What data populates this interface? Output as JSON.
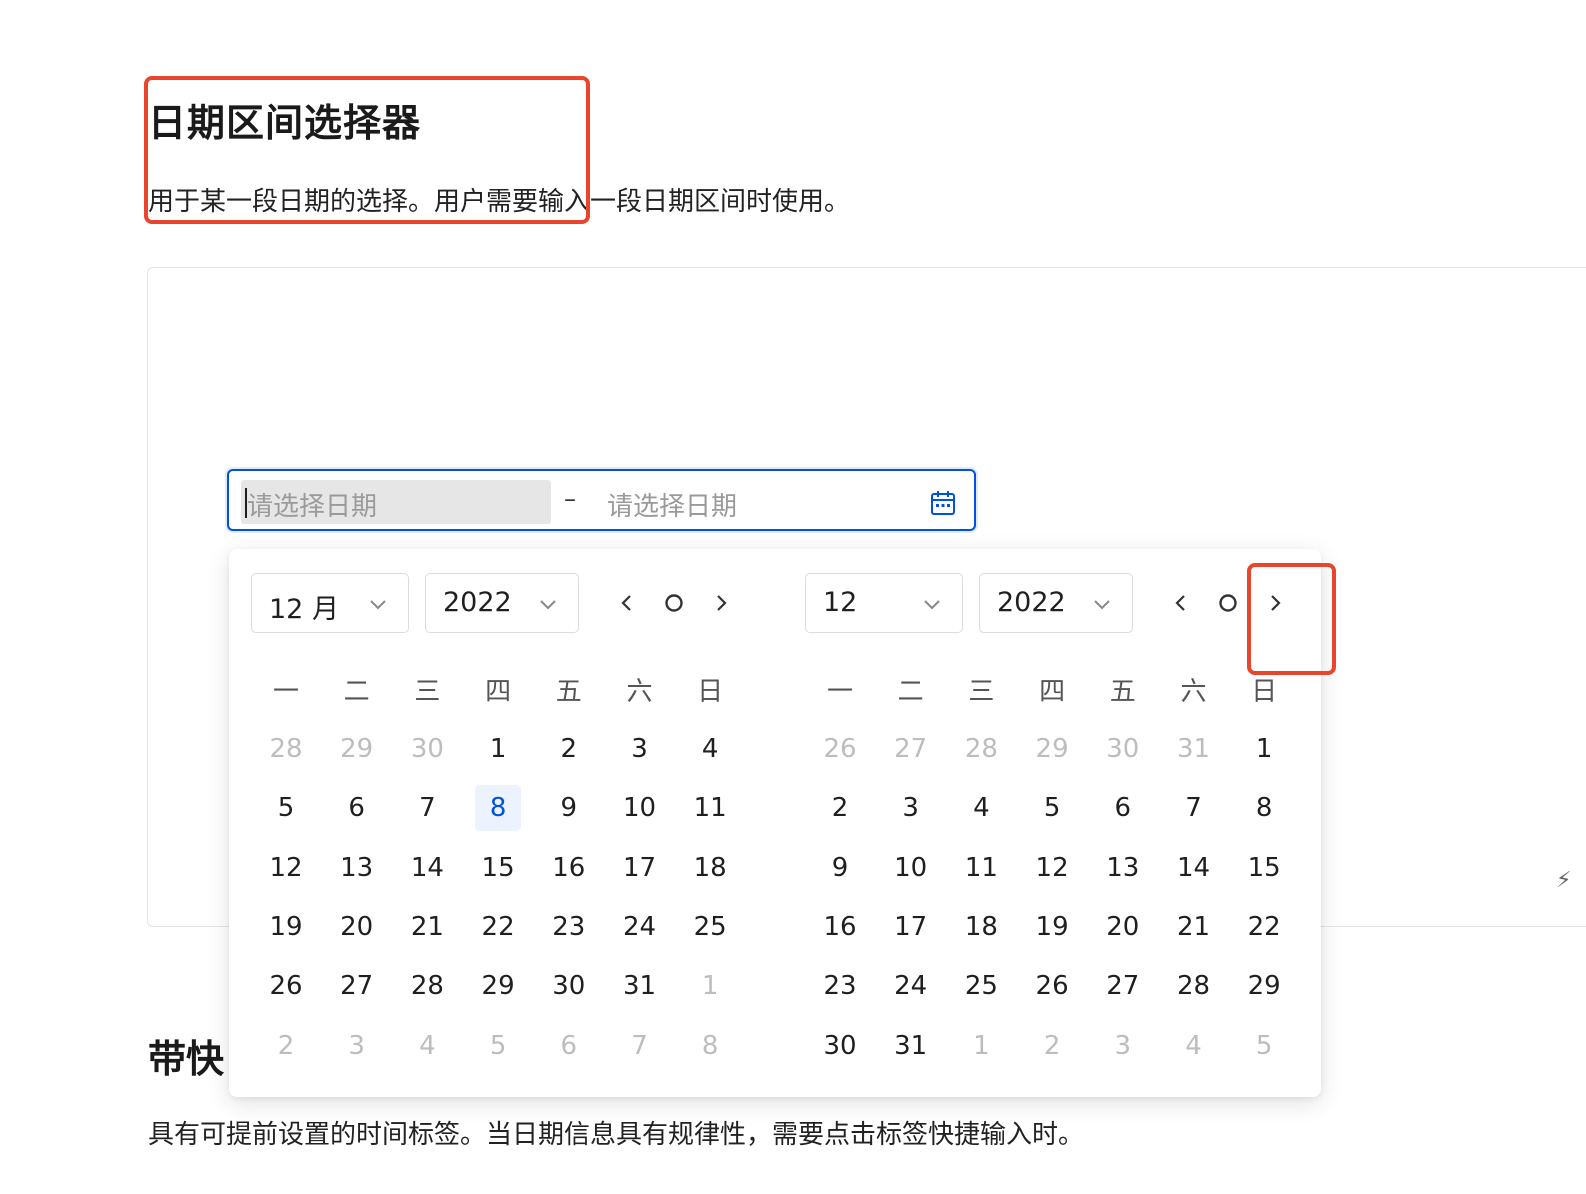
{
  "page": {
    "title": "日期区间选择器",
    "description": "用于某一段日期的选择。用户需要输入一段日期区间时使用。",
    "section2_title": "带快",
    "section2_description": "具有可提前设置的时间标签。当日期信息具有规律性，需要点击标签快捷输入时。"
  },
  "range_input": {
    "start_placeholder": "请选择日期",
    "separator": "–",
    "end_placeholder": "请选择日期",
    "icon": "calendar-icon"
  },
  "left_calendar": {
    "month_select": "12 月",
    "year_select": "2022",
    "nav": {
      "prev": "‹",
      "today": "○",
      "next": "›"
    },
    "weekdays": [
      "一",
      "二",
      "三",
      "四",
      "五",
      "六",
      "日"
    ],
    "weeks": [
      [
        {
          "d": "28",
          "m": true
        },
        {
          "d": "29",
          "m": true
        },
        {
          "d": "30",
          "m": true
        },
        {
          "d": "1"
        },
        {
          "d": "2"
        },
        {
          "d": "3"
        },
        {
          "d": "4"
        }
      ],
      [
        {
          "d": "5"
        },
        {
          "d": "6"
        },
        {
          "d": "7"
        },
        {
          "d": "8",
          "today": true
        },
        {
          "d": "9"
        },
        {
          "d": "10"
        },
        {
          "d": "11"
        }
      ],
      [
        {
          "d": "12"
        },
        {
          "d": "13"
        },
        {
          "d": "14"
        },
        {
          "d": "15"
        },
        {
          "d": "16"
        },
        {
          "d": "17"
        },
        {
          "d": "18"
        }
      ],
      [
        {
          "d": "19"
        },
        {
          "d": "20"
        },
        {
          "d": "21"
        },
        {
          "d": "22"
        },
        {
          "d": "23"
        },
        {
          "d": "24"
        },
        {
          "d": "25"
        }
      ],
      [
        {
          "d": "26"
        },
        {
          "d": "27"
        },
        {
          "d": "28"
        },
        {
          "d": "29"
        },
        {
          "d": "30"
        },
        {
          "d": "31"
        },
        {
          "d": "1",
          "m": true
        }
      ],
      [
        {
          "d": "2",
          "m": true
        },
        {
          "d": "3",
          "m": true
        },
        {
          "d": "4",
          "m": true
        },
        {
          "d": "5",
          "m": true
        },
        {
          "d": "6",
          "m": true
        },
        {
          "d": "7",
          "m": true
        },
        {
          "d": "8",
          "m": true
        }
      ]
    ]
  },
  "right_calendar": {
    "month_select": "12",
    "year_select": "2022",
    "nav": {
      "prev": "‹",
      "today": "○",
      "next": "›"
    },
    "weekdays": [
      "一",
      "二",
      "三",
      "四",
      "五",
      "六",
      "日"
    ],
    "weeks": [
      [
        {
          "d": "26",
          "m": true
        },
        {
          "d": "27",
          "m": true
        },
        {
          "d": "28",
          "m": true
        },
        {
          "d": "29",
          "m": true
        },
        {
          "d": "30",
          "m": true
        },
        {
          "d": "31",
          "m": true
        },
        {
          "d": "1"
        }
      ],
      [
        {
          "d": "2"
        },
        {
          "d": "3"
        },
        {
          "d": "4"
        },
        {
          "d": "5"
        },
        {
          "d": "6"
        },
        {
          "d": "7"
        },
        {
          "d": "8"
        }
      ],
      [
        {
          "d": "9"
        },
        {
          "d": "10"
        },
        {
          "d": "11"
        },
        {
          "d": "12"
        },
        {
          "d": "13"
        },
        {
          "d": "14"
        },
        {
          "d": "15"
        }
      ],
      [
        {
          "d": "16"
        },
        {
          "d": "17"
        },
        {
          "d": "18"
        },
        {
          "d": "19"
        },
        {
          "d": "20"
        },
        {
          "d": "21"
        },
        {
          "d": "22"
        }
      ],
      [
        {
          "d": "23"
        },
        {
          "d": "24"
        },
        {
          "d": "25"
        },
        {
          "d": "26"
        },
        {
          "d": "27"
        },
        {
          "d": "28"
        },
        {
          "d": "29"
        }
      ],
      [
        {
          "d": "30"
        },
        {
          "d": "31"
        },
        {
          "d": "1",
          "m": true
        },
        {
          "d": "2",
          "m": true
        },
        {
          "d": "3",
          "m": true
        },
        {
          "d": "4",
          "m": true
        },
        {
          "d": "5",
          "m": true
        }
      ]
    ]
  },
  "colors": {
    "accent": "#0052d9",
    "annotation": "#e8452c",
    "today_bg": "#ecf2fe",
    "muted": "#bdbdbd"
  }
}
